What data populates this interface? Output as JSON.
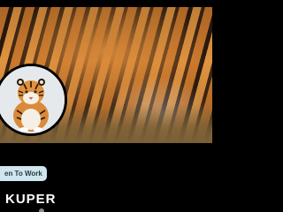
{
  "profile": {
    "badge_label": "en To Work",
    "name": "KUPER"
  },
  "colors": {
    "background": "#000000",
    "badge_bg": "#cfe6ee",
    "name_text": "#ffffff"
  },
  "icons": {
    "cover": "tiger-cover-image",
    "avatar": "tiger-avatar-image"
  }
}
